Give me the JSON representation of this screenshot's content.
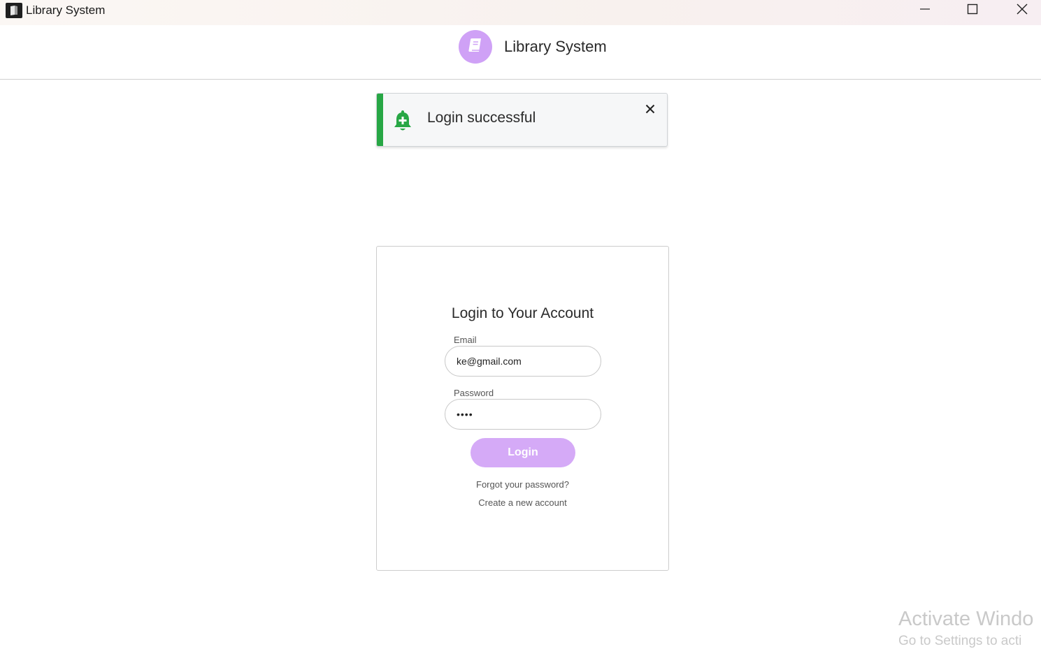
{
  "window": {
    "title": "Library System",
    "icon": "book-app-icon",
    "controls": [
      "minimize-icon",
      "maximize-icon",
      "close-icon"
    ]
  },
  "header": {
    "title": "Library System",
    "logo_icon": "book-icon",
    "logo_color": "#cfa1f6"
  },
  "toast": {
    "message": "Login successful",
    "icon": "bell-plus-icon",
    "accent_color": "#27a745",
    "close_icon": "close-icon"
  },
  "login_form": {
    "title": "Login to Your Account",
    "email_label": "Email",
    "email_value": "ke@gmail.com",
    "password_label": "Password",
    "password_value": "••••",
    "login_button": "Login",
    "button_color": "#d5aaf7",
    "forgot_link": "Forgot your password?",
    "create_link": "Create a new account"
  },
  "watermark": {
    "line1": "Activate Windo",
    "line2": "Go to Settings to acti"
  }
}
